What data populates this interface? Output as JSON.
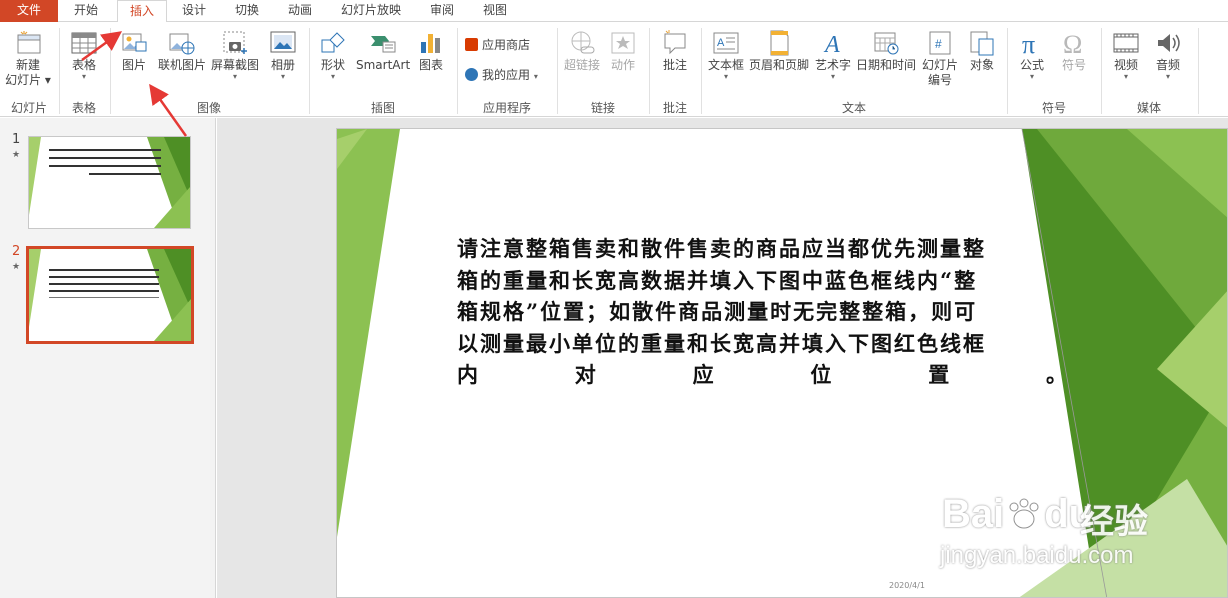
{
  "tabs": [
    {
      "label": "文件"
    },
    {
      "label": "开始"
    },
    {
      "label": "插入"
    },
    {
      "label": "设计"
    },
    {
      "label": "切换"
    },
    {
      "label": "动画"
    },
    {
      "label": "幻灯片放映"
    },
    {
      "label": "审阅"
    },
    {
      "label": "视图"
    }
  ],
  "ribbon": {
    "groups": {
      "slides": "幻灯片",
      "tables": "表格",
      "images": "图像",
      "illustrations": "插图",
      "apps": "应用程序",
      "links": "链接",
      "comments": "批注",
      "text": "文本",
      "symbols": "符号",
      "media": "媒体"
    },
    "buttons": {
      "new_slide_1": "新建",
      "new_slide_2": "幻灯片",
      "table": "表格",
      "picture": "图片",
      "online_picture": "联机图片",
      "screenshot": "屏幕截图",
      "album": "相册",
      "shapes": "形状",
      "smartart": "SmartArt",
      "chart": "图表",
      "store": "应用商店",
      "my_apps": "我的应用",
      "hyperlink": "超链接",
      "action": "动作",
      "comment": "批注",
      "textbox": "文本框",
      "header_footer": "页眉和页脚",
      "wordart": "艺术字",
      "datetime": "日期和时间",
      "slide_number_1": "幻灯片",
      "slide_number_2": "编号",
      "object": "对象",
      "equation": "公式",
      "symbol": "符号",
      "video": "视频",
      "audio": "音频"
    }
  },
  "thumbnails": [
    {
      "number": "1",
      "star": "★"
    },
    {
      "number": "2",
      "star": "★"
    }
  ],
  "slide": {
    "lines": [
      "请注意整箱售卖和散件售卖的商品应当都优先测量整",
      "箱的重量和长宽高数据并填入下图中蓝色框线内“整",
      "箱规格”位置；如散件商品测量时无完整整箱，则可",
      "以测量最小单位的重量和长宽高并填入下图红色线框"
    ],
    "last_chars": [
      "内",
      "对",
      "应",
      "位",
      "置",
      "。"
    ],
    "date": "2020/4/1"
  },
  "watermark": {
    "brand": "Bai",
    "brand2": "du",
    "product": "经验",
    "url": "jingyan.baidu.com"
  },
  "colors": {
    "accent": "#d24726",
    "green_dark": "#4e8f25",
    "green_mid": "#76b041",
    "green_light": "#a6cf6b"
  }
}
